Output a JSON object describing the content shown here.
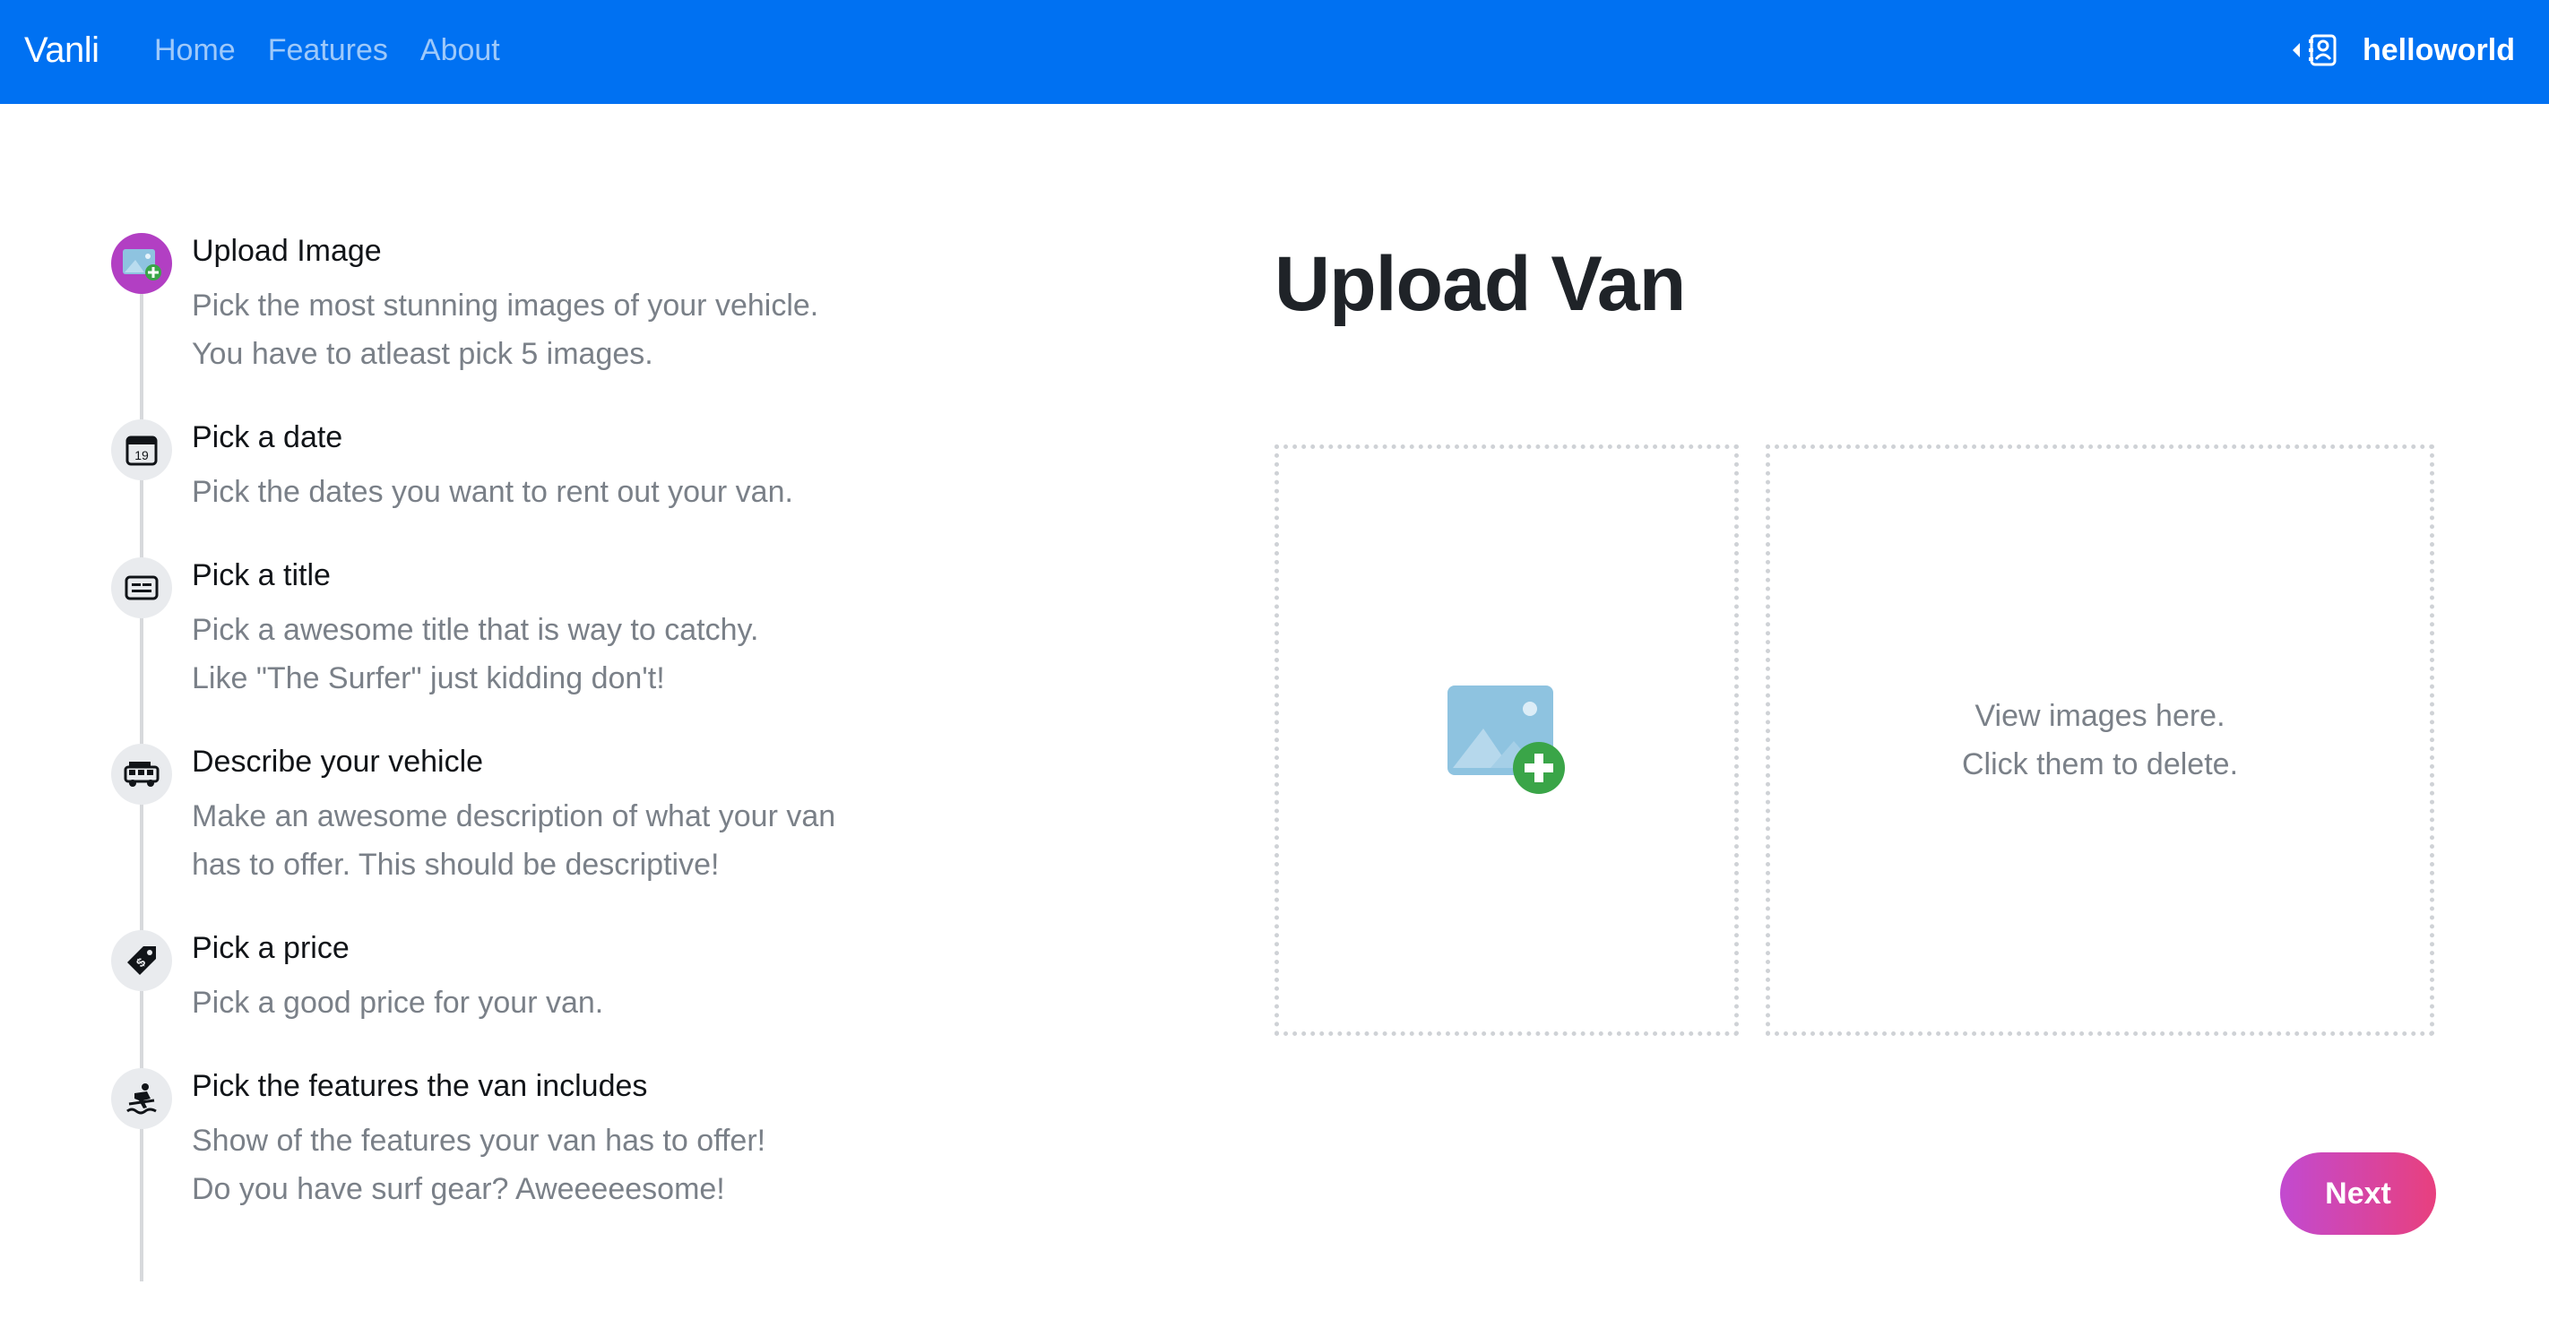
{
  "navbar": {
    "brand": "Vanli",
    "links": [
      {
        "label": "Home"
      },
      {
        "label": "Features"
      },
      {
        "label": "About"
      }
    ],
    "user": {
      "name": "helloworld",
      "icon": "user-profile-icon"
    },
    "colors": {
      "background": "#0071f2",
      "link": "rgba(255,255,255,0.62)",
      "text": "#ffffff"
    }
  },
  "steps": [
    {
      "title": "Upload Image",
      "desc": [
        "Pick the most stunning images of your vehicle.",
        "You have to atleast pick 5 images."
      ],
      "icon": "add-image-icon",
      "active": true
    },
    {
      "title": "Pick a date",
      "desc": [
        "Pick the dates you want to rent out your van."
      ],
      "icon": "calendar-icon",
      "active": false
    },
    {
      "title": "Pick a title",
      "desc": [
        "Pick a awesome title that is way to catchy.",
        "Like \"The Surfer\" just kidding don't!"
      ],
      "icon": "subtitles-icon",
      "active": false
    },
    {
      "title": "Describe your vehicle",
      "desc": [
        "Make an awesome description of what your van",
        "has to offer. This should be descriptive!"
      ],
      "icon": "van-icon",
      "active": false
    },
    {
      "title": "Pick a price",
      "desc": [
        "Pick a good price for your van."
      ],
      "icon": "price-tag-icon",
      "active": false
    },
    {
      "title": "Pick the features the van includes",
      "desc": [
        "Show of the features your van has to offer!",
        "Do you have surf gear? Aweeeeesome!"
      ],
      "icon": "surfer-icon",
      "active": false
    }
  ],
  "main": {
    "title": "Upload Van",
    "dropzone_icon": "add-image-icon",
    "preview_text": [
      "View images here.",
      "Click them to delete."
    ],
    "next_label": "Next",
    "colors": {
      "active_step": "#b23fc3",
      "next_from": "#c24ad0",
      "next_to": "#e8407e",
      "muted_text": "#7a8088"
    }
  }
}
